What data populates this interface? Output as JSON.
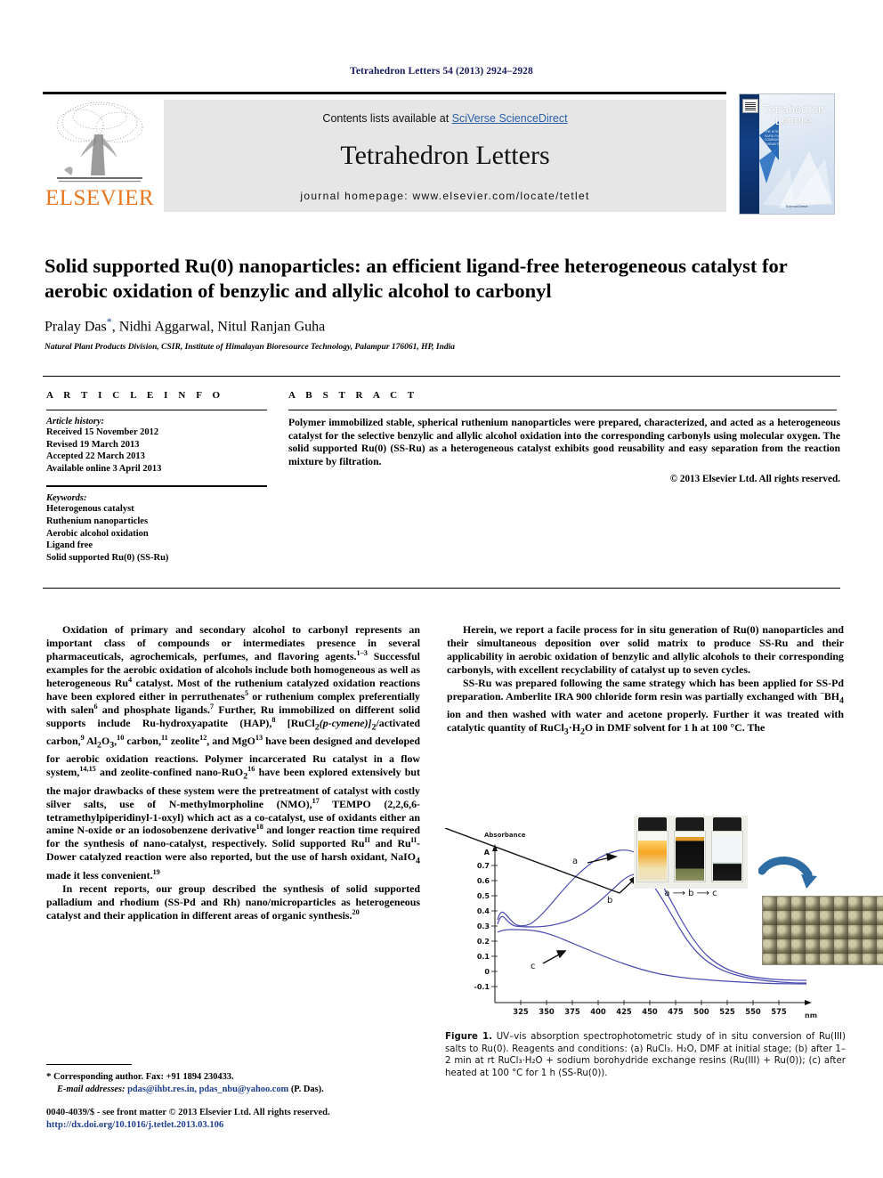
{
  "running_head": "Tetrahedron Letters 54 (2013) 2924–2928",
  "masthead": {
    "contents_prefix": "Contents lists available at ",
    "sciencedirect": "SciVerse ScienceDirect",
    "journal_name": "Tetrahedron Letters",
    "homepage": "journal homepage: www.elsevier.com/locate/tetlet",
    "publisher_wordmark": "ELSEVIER",
    "cover_title_line1": "Tetrahedron",
    "cover_title_line2": "Letters",
    "cover_subtitle": "THE INTERNATIONAL JOURNAL FOR THE RAPID PUBLICATION OF PRELIMINARY COMMUNICATIONS IN ORGANIC CHEMISTRY",
    "cover_footer": "ScienceDirect",
    "accent_orange": "#e87722",
    "link_blue": "#2b5fa8",
    "banner_grey": "#e6e6e6"
  },
  "title": "Solid supported Ru(0) nanoparticles: an efficient ligand-free heterogeneous catalyst for aerobic oxidation of benzylic and allylic alcohol to carbonyl",
  "authors": "Pralay Das",
  "authors_rest": ", Nidhi Aggarwal, Nitul Ranjan Guha",
  "corresponding_marker": "*",
  "affiliation": "Natural Plant Products Division, CSIR, Institute of Himalayan Bioresource Technology, Palampur 176061, HP, India",
  "article_info": {
    "heading": "A R T I C L E  I N F O",
    "history_label": "Article history:",
    "history": [
      "Received 15 November 2012",
      "Revised 19 March 2013",
      "Accepted 22 March 2013",
      "Available online 3 April 2013"
    ],
    "keywords_label": "Keywords:",
    "keywords": [
      "Heterogenous catalyst",
      "Ruthenium nanoparticles",
      "Aerobic alcohol oxidation",
      "Ligand free",
      "Solid supported Ru(0) (SS-Ru)"
    ]
  },
  "abstract": {
    "heading": "A B S T R A C T",
    "text": "Polymer immobilized stable, spherical ruthenium nanoparticles were prepared, characterized, and acted as a heterogeneous catalyst for the selective benzylic and allylic alcohol oxidation into the corresponding carbonyls using molecular oxygen. The solid supported Ru(0) (SS-Ru) as a heterogeneous catalyst exhibits good reusability and easy separation from the reaction mixture by filtration.",
    "copyright": "© 2013 Elsevier Ltd. All rights reserved."
  },
  "body": {
    "left_p1_a": "Oxidation of primary and secondary alcohol to carbonyl represents an important class of compounds or intermediates presence in several pharmaceuticals, agrochemicals, perfumes, and flavoring agents.",
    "left_p1_sup1": "1–3",
    "left_p1_b": " Successful examples for the aerobic oxidation of alcohols include both homogeneous as well as heterogeneous Ru",
    "left_p1_sup2": "4",
    "left_p1_c": " catalyst. Most of the ruthenium catalyzed oxidation reactions have been explored either in perruthenates",
    "left_p1_sup3": "5",
    "left_p1_d": " or ruthenium complex preferentially with salen",
    "left_p1_sup4": "6",
    "left_p1_e": " and phosphate ligands.",
    "left_p1_sup5": "7",
    "left_p1_f": " Further, Ru immobilized on different solid supports include Ru-hydroxyapatite (HAP),",
    "left_p1_sup6": "8",
    "left_p1_g": " [RuCl",
    "left_p1_h": "(p-cymene)]",
    "left_p1_i": "/activated carbon,",
    "left_p1_sup7": "9",
    "left_p1_j": " Al",
    "left_p1_k": "O",
    "left_p1_sup8": "10",
    "left_p1_l": " carbon,",
    "left_p1_sup9": "11",
    "left_p1_m": " zeolite",
    "left_p1_sup10": "12",
    "left_p1_n": " and MgO",
    "left_p1_sup11": "13",
    "left_p1_o": " have been designed and developed for aerobic oxidation reactions. Polymer incarcerated Ru catalyst in a flow system,",
    "left_p1_sup12": "14,15",
    "left_p1_p": " and zeolite-confined nano-RuO",
    "left_p1_sup13": "16",
    "left_p1_q": " have been explored extensively but the major drawbacks of these system were the pretreatment of catalyst with costly silver salts, use of N-methylmorpholine (NMO),",
    "left_p1_sup14": "17",
    "left_p1_r": " TEMPO (2,2,6,6-tetramethylpiperidinyl-1-oxyl) which act as a co-catalyst, use of oxidants either an amine N-oxide or an iodosobenzene derivative",
    "left_p1_sup15": "18",
    "left_p1_s": " and longer reaction time required for the synthesis of nano-catalyst, respectively. Solid supported Ru",
    "left_p1_t": " and Ru",
    "left_p1_u": "-Dower catalyzed reaction were also reported, but the use of harsh oxidant, NaIO",
    "left_p1_v": " made it less convenient.",
    "left_p1_sup16": "19",
    "left_p2_a": "In recent reports, our group described the synthesis of solid supported palladium and rhodium (SS-Pd and Rh) nano/microparticles as heterogeneous catalyst and their application in different areas of organic synthesis.",
    "left_p2_sup": "20",
    "right_p1": "Herein, we report a facile process for in situ generation of Ru(0) nanoparticles and their simultaneous deposition over solid matrix to produce SS-Ru and their applicability in aerobic oxidation of benzylic and allylic alcohols to their corresponding carbonyls, with excellent recyclability of catalyst up to seven cycles.",
    "right_p2_a": "SS-Ru was prepared following the same strategy which has been applied for SS-Pd preparation. Amberlite IRA 900 chloride form resin was partially exchanged with ",
    "right_p2_bh4": "BH",
    "right_p2_b": " ion and then washed with water and acetone properly. Further it was treated with catalytic quantity of RuCl",
    "right_p2_c": "·H",
    "right_p2_d": "O in DMF solvent for 1 h at 100 °C. The"
  },
  "footnote": {
    "marker": "*",
    "line1": " Corresponding author. Fax: +91 1894 230433.",
    "email_label": "E-mail addresses:",
    "emails": "pdas@ihbt.res.in, pdas_nbu@yahoo.com",
    "email_tail": " (P. Das)."
  },
  "imprint": {
    "line1": "0040-4039/$ - see front matter © 2013 Elsevier Ltd. All rights reserved.",
    "doi": "http://dx.doi.org/10.1016/j.tetlet.2013.03.106"
  },
  "figure": {
    "label": "Figure 1.",
    "caption": " UV–vis absorption spectrophotometric study of in situ conversion of Ru(III) salts to Ru(0). Reagents and conditions: (a) RuCl₃. H₂O, DMF at initial stage; (b) after 1–2 min at rt RuCl₃·H₂O + sodium borohydride exchange resins (Ru(III) + Ru(0)); (c) after heated at 100 °C for 1 h (SS-Ru(0)).",
    "vial_sequence": "a ⟶ b ⟶ c",
    "vial_labels": [
      "a",
      "b",
      "c"
    ]
  },
  "chart_data": {
    "type": "line",
    "title": "",
    "ylabel": "Absorbance",
    "y_axis_symbol": "A",
    "xlabel": "nm",
    "xlim": [
      310,
      595
    ],
    "ylim": [
      -0.1,
      0.8
    ],
    "yticks": [
      "0.7",
      "0.6",
      "0.5",
      "0.4",
      "0.3",
      "0.2",
      "0.1",
      "0",
      "-0.1"
    ],
    "ytick_values": [
      0.7,
      0.6,
      0.5,
      0.4,
      0.3,
      0.2,
      0.1,
      0,
      -0.1
    ],
    "xticks": [
      "325",
      "350",
      "375",
      "400",
      "425",
      "450",
      "475",
      "500",
      "525",
      "550",
      "575"
    ],
    "xtick_values": [
      325,
      350,
      375,
      400,
      425,
      450,
      475,
      500,
      525,
      550,
      575
    ],
    "grid": false,
    "legend": [
      "a",
      "b",
      "c"
    ],
    "annotations": [
      "a",
      "b",
      "c"
    ],
    "line_color": "#3b3b9e",
    "series": [
      {
        "name": "a",
        "x": [
          310,
          315,
          320,
          325,
          330,
          335,
          340,
          345,
          350,
          360,
          370,
          380,
          390,
          400,
          410,
          420,
          425,
          430,
          435,
          440,
          450,
          460,
          470,
          480,
          490,
          500,
          510,
          520,
          530,
          540,
          550,
          560,
          570,
          580,
          590
        ],
        "y": [
          0.34,
          0.37,
          0.36,
          0.355,
          0.345,
          0.33,
          0.32,
          0.325,
          0.335,
          0.38,
          0.44,
          0.52,
          0.6,
          0.67,
          0.72,
          0.755,
          0.765,
          0.77,
          0.768,
          0.76,
          0.72,
          0.66,
          0.57,
          0.47,
          0.38,
          0.3,
          0.23,
          0.175,
          0.135,
          0.11,
          0.095,
          0.085,
          0.078,
          0.072,
          0.068
        ]
      },
      {
        "name": "b",
        "x": [
          310,
          315,
          320,
          325,
          330,
          335,
          340,
          345,
          350,
          360,
          370,
          380,
          390,
          400,
          410,
          420,
          430,
          435,
          440,
          450,
          460,
          470,
          480,
          490,
          500,
          510,
          520,
          530,
          540,
          550,
          560,
          570,
          580,
          590
        ],
        "y": [
          0.32,
          0.355,
          0.35,
          0.345,
          0.335,
          0.325,
          0.315,
          0.315,
          0.315,
          0.325,
          0.345,
          0.375,
          0.415,
          0.47,
          0.535,
          0.595,
          0.64,
          0.645,
          0.64,
          0.6,
          0.535,
          0.45,
          0.365,
          0.285,
          0.215,
          0.165,
          0.13,
          0.105,
          0.09,
          0.08,
          0.072,
          0.068,
          0.062,
          0.058
        ]
      },
      {
        "name": "c",
        "x": [
          310,
          315,
          320,
          325,
          330,
          335,
          340,
          345,
          350,
          360,
          370,
          380,
          390,
          400,
          410,
          420,
          430,
          440,
          450,
          460,
          470,
          480,
          490,
          500,
          510,
          520,
          530,
          540,
          550,
          560,
          570,
          580,
          590
        ],
        "y": [
          0.265,
          0.27,
          0.272,
          0.272,
          0.27,
          0.268,
          0.265,
          0.26,
          0.255,
          0.235,
          0.215,
          0.2,
          0.185,
          0.17,
          0.155,
          0.14,
          0.125,
          0.112,
          0.1,
          0.09,
          0.082,
          0.078,
          0.074,
          0.072,
          0.07,
          0.068,
          0.065,
          0.062,
          0.058,
          0.055,
          0.052,
          0.05,
          0.048
        ]
      }
    ]
  }
}
